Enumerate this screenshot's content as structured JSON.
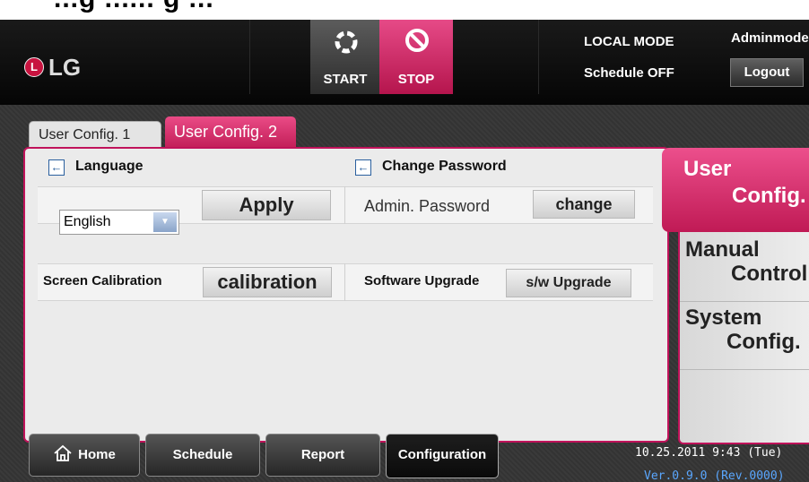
{
  "caption": "...g ...... g ...",
  "header": {
    "logo_text": "LG",
    "start_label": "START",
    "stop_label": "STOP",
    "local_mode": "LOCAL MODE",
    "schedule_status": "Schedule  OFF",
    "user_mode": "Adminmode",
    "logout_label": "Logout"
  },
  "tabs": [
    {
      "label": "User Config. 1",
      "active": false
    },
    {
      "label": "User Config. 2",
      "active": true
    }
  ],
  "language": {
    "title": "Language",
    "selected": "English",
    "apply_label": "Apply"
  },
  "password": {
    "title": "Change Password",
    "field_label": "Admin. Password",
    "change_label": "change"
  },
  "calibration": {
    "label": "Screen Calibration",
    "button_label": "calibration"
  },
  "upgrade": {
    "label": "Software Upgrade",
    "button_label": "s/w Upgrade"
  },
  "side_menu": [
    {
      "line1": "User",
      "line2": "Config.",
      "active": true
    },
    {
      "line1": "Manual",
      "line2": "Control",
      "active": false
    },
    {
      "line1": "System",
      "line2": "Config.",
      "active": false
    }
  ],
  "bottom_nav": [
    {
      "label": "Home",
      "icon": "home-icon"
    },
    {
      "label": "Schedule"
    },
    {
      "label": "Report"
    },
    {
      "label": "Configuration",
      "active": true
    }
  ],
  "status": {
    "datetime": "10.25.2011  9:43  (Tue)",
    "version": "Ver.0.9.0 (Rev.0000)"
  },
  "colors": {
    "accent_pink": "#c8135a",
    "header_bg": "#0a0a0a",
    "panel_bg": "#ebebeb",
    "version_blue": "#5aa7ff"
  }
}
